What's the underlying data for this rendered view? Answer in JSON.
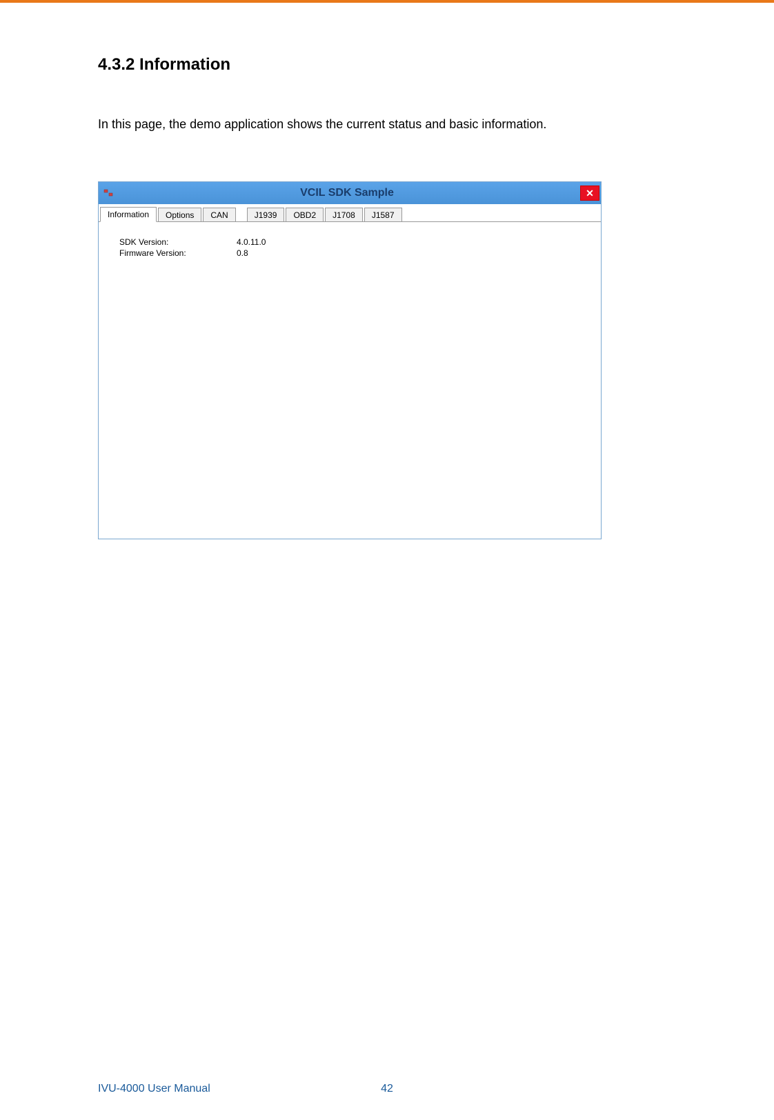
{
  "heading": "4.3.2 Information",
  "body_text": "In this page, the demo application shows the current status and basic information.",
  "window": {
    "title": "VCIL SDK Sample",
    "tabs": [
      {
        "label": "Information"
      },
      {
        "label": "Options"
      },
      {
        "label": "CAN"
      },
      {
        "label": "J1939"
      },
      {
        "label": "OBD2"
      },
      {
        "label": "J1708"
      },
      {
        "label": "J1587"
      }
    ],
    "info": {
      "sdk_version_label": "SDK Version:",
      "sdk_version_value": "4.0.11.0",
      "firmware_version_label": "Firmware Version:",
      "firmware_version_value": "0.8"
    }
  },
  "footer": {
    "manual": "IVU-4000 User Manual",
    "page": "42"
  }
}
